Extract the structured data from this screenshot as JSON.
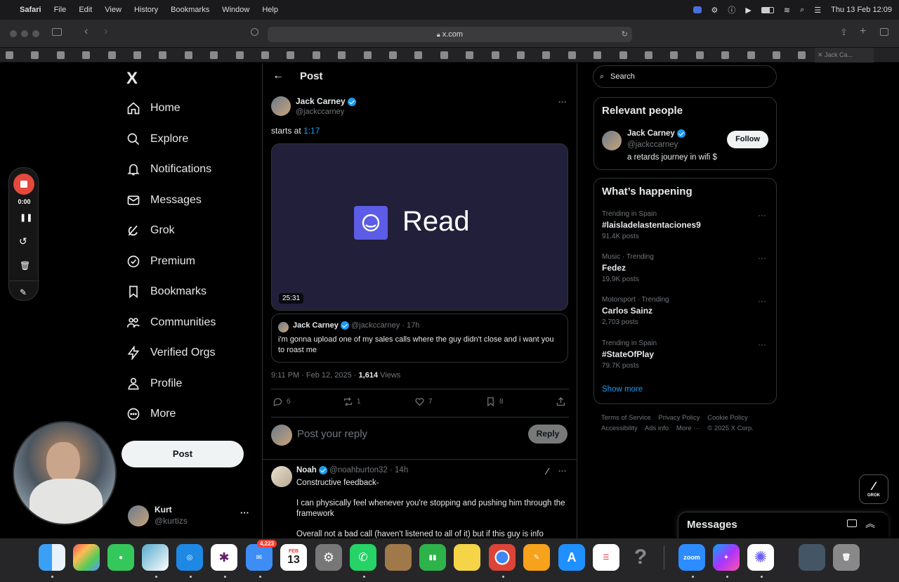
{
  "menubar": {
    "app": "Safari",
    "items": [
      "File",
      "Edit",
      "View",
      "History",
      "Bookmarks",
      "Window",
      "Help"
    ],
    "datetime": "Thu 13 Feb  12:09"
  },
  "browser": {
    "url": "x.com",
    "active_tab": "Jack Ca..."
  },
  "nav": {
    "logo": "X",
    "items": [
      {
        "label": "Home",
        "icon": "home-icon"
      },
      {
        "label": "Explore",
        "icon": "search-icon"
      },
      {
        "label": "Notifications",
        "icon": "bell-icon"
      },
      {
        "label": "Messages",
        "icon": "mail-icon"
      },
      {
        "label": "Grok",
        "icon": "grok-icon"
      },
      {
        "label": "Premium",
        "icon": "premium-icon"
      },
      {
        "label": "Bookmarks",
        "icon": "bookmark-icon"
      },
      {
        "label": "Communities",
        "icon": "communities-icon"
      },
      {
        "label": "Verified Orgs",
        "icon": "lightning-icon"
      },
      {
        "label": "Profile",
        "icon": "profile-icon"
      },
      {
        "label": "More",
        "icon": "more-circle-icon"
      }
    ],
    "post_button": "Post",
    "account": {
      "name": "Kurt",
      "handle": "@kurtizs"
    }
  },
  "post": {
    "header_title": "Post",
    "author": {
      "name": "Jack Carney",
      "handle": "@jackccarney"
    },
    "text_prefix": "starts at ",
    "timestamp_link": "1:17",
    "media": {
      "brand": "Read",
      "duration": "25:31"
    },
    "quote": {
      "name": "Jack Carney",
      "handle": "@jackccarney",
      "age": "· 17h",
      "text": "i'm gonna upload one of my sales calls where the guy didn't close and i want you to roast me"
    },
    "meta_time": "9:11 PM · Feb 12, 2025 · ",
    "views_count": "1,614",
    "views_label": " Views",
    "stats": {
      "replies": "6",
      "reposts": "1",
      "likes": "7",
      "bookmarks": "8"
    },
    "reply_placeholder": "Post your reply",
    "reply_button": "Reply"
  },
  "reply": {
    "name": "Noah",
    "handle": "@noahburton32",
    "age": "· 14h",
    "line1": "Constructive feedback-",
    "line2": "I can physically feel whenever you're stopping and pushing him through the framework",
    "line3": "Overall not a bad call (haven't listened to all of it) but if this guy is info"
  },
  "sidebar": {
    "search_placeholder": "Search",
    "relevant_title": "Relevant people",
    "person": {
      "name": "Jack Carney",
      "handle": "@jackccarney",
      "bio": "a retards journey in wifi $",
      "follow": "Follow"
    },
    "happening_title": "What’s happening",
    "trends": [
      {
        "category": "Trending in Spain",
        "name": "#laisladelastentaciones9",
        "count": "91.4K posts"
      },
      {
        "category": "Music · Trending",
        "name": "Fedez",
        "count": "19.9K posts"
      },
      {
        "category": "Motorsport · Trending",
        "name": "Carlos Sainz",
        "count": "2,703 posts"
      },
      {
        "category": "Trending in Spain",
        "name": "#StateOfPlay",
        "count": "79.7K posts"
      }
    ],
    "show_more": "Show more",
    "footer": {
      "links1": [
        "Terms of Service",
        "Privacy Policy",
        "Cookie Policy"
      ],
      "links2": [
        "Accessibility",
        "Ads info",
        "More ···",
        "© 2025 X Corp."
      ]
    }
  },
  "messages_drawer": {
    "title": "Messages"
  },
  "grok_button": {
    "label": "GROK"
  },
  "recorder": {
    "time": "0:00"
  },
  "dock": {
    "mail_badge": "4,223",
    "calendar_month": "FEB",
    "calendar_day": "13",
    "zoom_label": "zoom"
  },
  "colors": {
    "accent": "#1d9bf0",
    "background": "#000000",
    "border": "#2f3336",
    "media_bg": "#221f3a",
    "read_logo": "#5c5ce6"
  }
}
